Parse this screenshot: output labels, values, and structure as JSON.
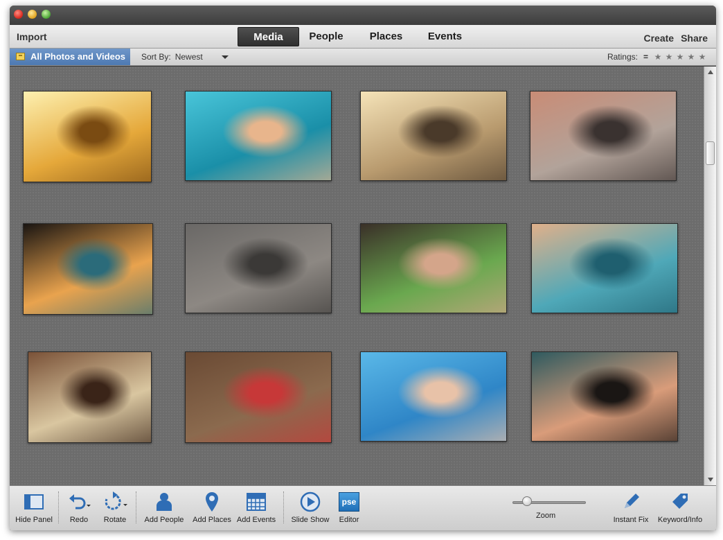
{
  "nav": {
    "import": "Import",
    "tabs": [
      "Media",
      "People",
      "Places",
      "Events"
    ],
    "create": "Create",
    "share": "Share"
  },
  "subbar": {
    "album": "All Photos and Videos",
    "sort_label": "Sort By:",
    "sort_value": "Newest",
    "ratings_label": "Ratings:",
    "ratings_filter": "=",
    "stars": [
      "★",
      "★",
      "★",
      "★",
      "★"
    ]
  },
  "photos": [
    {
      "subject": "kitchen-shelves",
      "colors": [
        "#fdf0b0",
        "#e5a83a",
        "#7a4b12"
      ]
    },
    {
      "subject": "girl-goggles-pool",
      "colors": [
        "#49c5d9",
        "#1a8fa8",
        "#e8b58c"
      ]
    },
    {
      "subject": "woman-rail-sunset",
      "colors": [
        "#f5e3b8",
        "#b89a6e",
        "#4a3a2a"
      ]
    },
    {
      "subject": "woman-palm-trees",
      "colors": [
        "#c98c76",
        "#b2a39a",
        "#3a3230"
      ]
    },
    {
      "subject": "kids-reading-book",
      "colors": [
        "#1a1512",
        "#e9a34e",
        "#2b6b7a"
      ]
    },
    {
      "subject": "tabby-cat",
      "colors": [
        "#6a6866",
        "#8d8883",
        "#3b3937"
      ]
    },
    {
      "subject": "woman-green-stripes",
      "colors": [
        "#3a3028",
        "#6aa84f",
        "#d4a58a"
      ]
    },
    {
      "subject": "ducks-lake",
      "colors": [
        "#e0b08a",
        "#4fa8b8",
        "#1f5f6f"
      ]
    },
    {
      "subject": "woman-old-truck",
      "colors": [
        "#7a5238",
        "#d9c6a0",
        "#3a2418"
      ]
    },
    {
      "subject": "woman-wooden-fence",
      "colors": [
        "#6a4a34",
        "#8b6a4e",
        "#c73838"
      ]
    },
    {
      "subject": "girl-underwater",
      "colors": [
        "#5ab8e8",
        "#2f86c7",
        "#e8c2a8"
      ]
    },
    {
      "subject": "toddler-surprised",
      "colors": [
        "#2f5a5f",
        "#d99c7a",
        "#1a1614"
      ]
    }
  ],
  "toolbar": {
    "hide_panel": "Hide Panel",
    "redo": "Redo",
    "rotate": "Rotate",
    "add_people": "Add People",
    "add_places": "Add Places",
    "add_events": "Add Events",
    "slide_show": "Slide Show",
    "editor": "Editor",
    "editor_badge": "pse",
    "zoom": "Zoom",
    "zoom_level": 0.2,
    "instant_fix": "Instant Fix",
    "keyword_info": "Keyword/Info"
  },
  "colors": {
    "accent": "#5b85bd",
    "editor_badge": "#1f7fc7",
    "toolbar_icon": "#2f6db5"
  }
}
